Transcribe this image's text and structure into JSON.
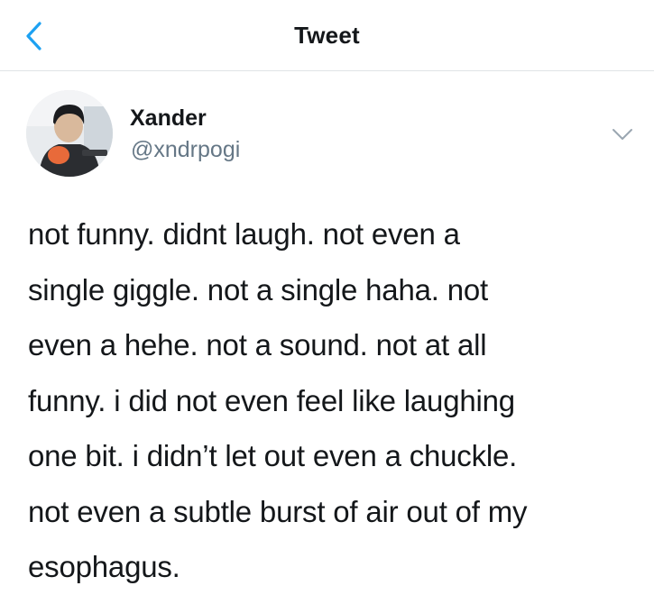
{
  "nav": {
    "title": "Tweet",
    "back_icon": "chevron-left-icon"
  },
  "tweet": {
    "author": {
      "name": "Xander",
      "handle": "@xndrpogi"
    },
    "menu_icon": "chevron-down-icon",
    "text": "not funny. didnt laugh. not even a\nsingle giggle. not a single haha. not\neven a hehe. not a sound. not at all\nfunny. i did not even feel like laughing\none bit. i didn’t let out even a chuckle.\nnot even a subtle burst of air out of my\nesophagus."
  },
  "colors": {
    "accent": "#1da1f2",
    "text": "#14171a",
    "secondary_text": "#657786",
    "divider": "#dfe3e6"
  }
}
